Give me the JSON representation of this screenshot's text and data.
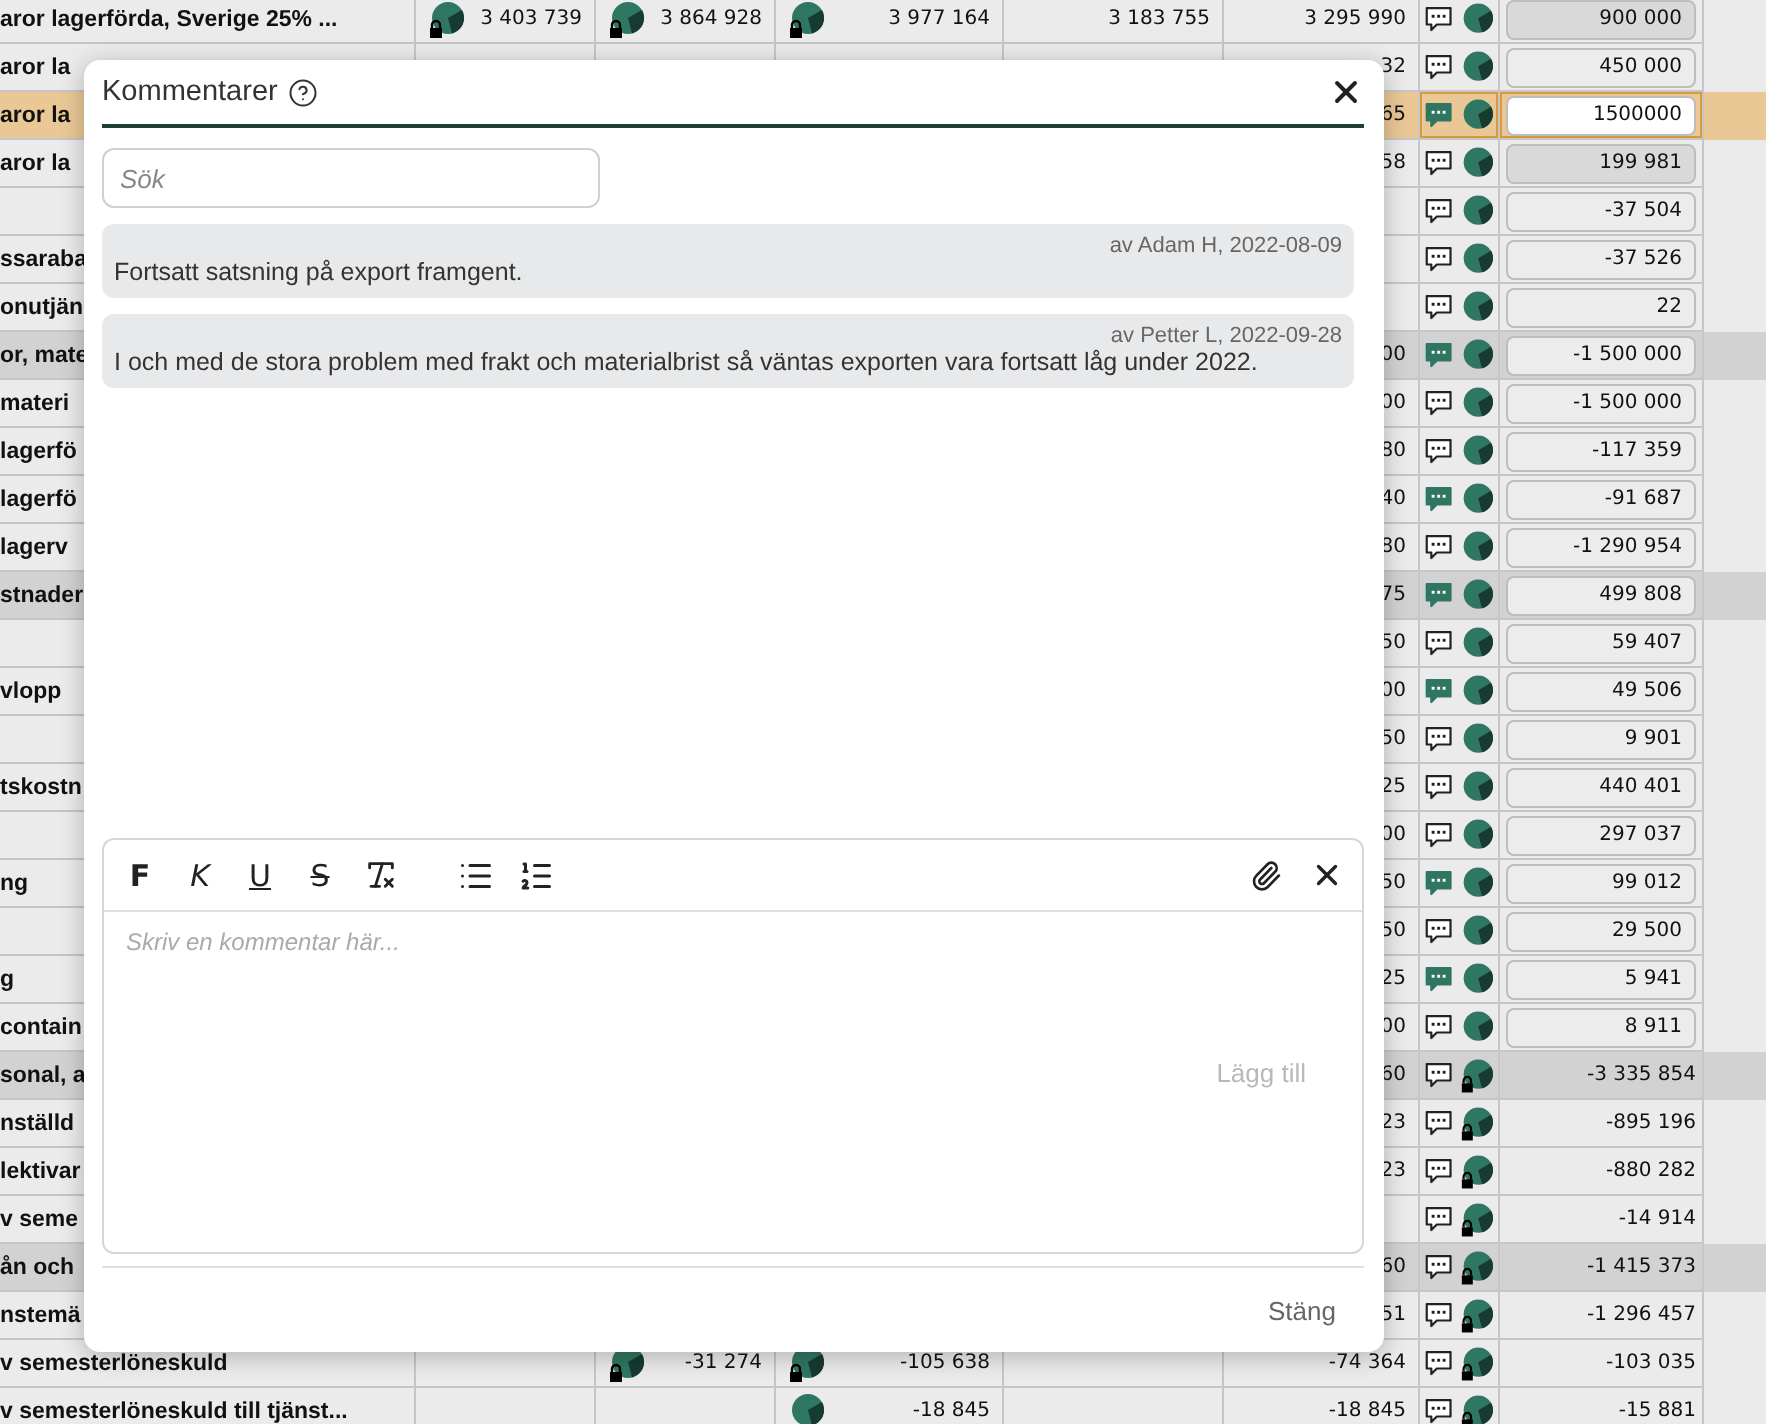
{
  "table": {
    "rows": [
      {
        "name": "aror lagerförda, Sverige 25% ...",
        "group": false,
        "selected": false,
        "column_1": {
          "text": "3 403 739",
          "chart_icon": true,
          "locked": true
        },
        "column_2": {
          "text": "3 864 928",
          "chart_icon": true,
          "locked": true
        },
        "column_3": {
          "text": "3 977 164",
          "chart_icon": true,
          "locked": true
        },
        "column_4": {
          "text": "3 183 755"
        },
        "column_5": {
          "text": "3 295 990"
        },
        "commented": false,
        "value_locked": false,
        "value": "900 000",
        "kind": "field",
        "edited": true
      },
      {
        "name": "aror la",
        "group": false,
        "selected": false,
        "column_5": {
          "text": "32"
        },
        "commented": false,
        "value_locked": false,
        "value": "450 000",
        "kind": "field",
        "edited": false
      },
      {
        "name": "aror la",
        "group": false,
        "selected": true,
        "column_5": {
          "text": "65"
        },
        "commented": true,
        "value_locked": false,
        "value": "1500000",
        "kind": "field",
        "edited": false
      },
      {
        "name": "aror la",
        "group": false,
        "selected": false,
        "column_5": {
          "text": "58"
        },
        "commented": false,
        "value_locked": false,
        "value": "199 981",
        "kind": "field",
        "edited": true
      },
      {
        "group": false,
        "selected": false,
        "commented": false,
        "value_locked": false,
        "value": "-37 504",
        "kind": "field",
        "edited": false
      },
      {
        "name": "ssaraba",
        "group": false,
        "selected": false,
        "commented": false,
        "value_locked": false,
        "value": "-37 526",
        "kind": "field",
        "edited": false
      },
      {
        "name": "onutjän",
        "group": false,
        "selected": false,
        "commented": false,
        "value_locked": false,
        "value": "22",
        "kind": "field",
        "edited": false
      },
      {
        "name": "or, mate",
        "group": true,
        "selected": false,
        "column_5": {
          "text": "00"
        },
        "commented": true,
        "value_locked": false,
        "value": "-1 500 000",
        "kind": "field",
        "edited": false
      },
      {
        "name": "materi",
        "group": false,
        "selected": false,
        "column_5": {
          "text": "00"
        },
        "commented": false,
        "value_locked": false,
        "value": "-1 500 000",
        "kind": "field",
        "edited": false
      },
      {
        "name": "lagerfö",
        "group": false,
        "selected": false,
        "column_5": {
          "text": "80"
        },
        "commented": false,
        "value_locked": false,
        "value": "-117 359",
        "kind": "field",
        "edited": false
      },
      {
        "name": "lagerfö",
        "group": false,
        "selected": false,
        "column_5": {
          "text": "40"
        },
        "commented": true,
        "value_locked": false,
        "value": "-91 687",
        "kind": "field",
        "edited": false
      },
      {
        "name": "lagerv",
        "group": false,
        "selected": false,
        "column_5": {
          "text": "80"
        },
        "commented": false,
        "value_locked": false,
        "value": "-1 290 954",
        "kind": "field",
        "edited": false
      },
      {
        "name": "stnader",
        "group": true,
        "selected": false,
        "column_5": {
          "text": "75"
        },
        "commented": true,
        "value_locked": false,
        "value": "499 808",
        "kind": "field",
        "edited": false
      },
      {
        "group": false,
        "selected": false,
        "column_5": {
          "text": "50"
        },
        "commented": false,
        "value_locked": false,
        "value": "59 407",
        "kind": "field",
        "edited": false
      },
      {
        "name": "vlopp",
        "group": false,
        "selected": false,
        "column_5": {
          "text": "00"
        },
        "commented": true,
        "value_locked": false,
        "value": "49 506",
        "kind": "field",
        "edited": false
      },
      {
        "group": false,
        "selected": false,
        "column_5": {
          "text": "50"
        },
        "commented": false,
        "value_locked": false,
        "value": "9 901",
        "kind": "field",
        "edited": false
      },
      {
        "name": "tskostn",
        "group": false,
        "selected": false,
        "column_5": {
          "text": "25"
        },
        "commented": false,
        "value_locked": false,
        "value": "440 401",
        "kind": "field",
        "edited": false
      },
      {
        "group": false,
        "selected": false,
        "column_5": {
          "text": "00"
        },
        "commented": false,
        "value_locked": false,
        "value": "297 037",
        "kind": "field",
        "edited": false
      },
      {
        "name": "ng",
        "group": false,
        "selected": false,
        "column_5": {
          "text": "50"
        },
        "commented": true,
        "value_locked": false,
        "value": "99 012",
        "kind": "field",
        "edited": false
      },
      {
        "group": false,
        "selected": false,
        "column_5": {
          "text": "50"
        },
        "commented": false,
        "value_locked": false,
        "value": "29 500",
        "kind": "field",
        "edited": false
      },
      {
        "name": "g",
        "group": false,
        "selected": false,
        "column_5": {
          "text": "25"
        },
        "commented": true,
        "value_locked": false,
        "value": "5 941",
        "kind": "field",
        "edited": false
      },
      {
        "name": "contain",
        "group": false,
        "selected": false,
        "column_5": {
          "text": "00"
        },
        "commented": false,
        "value_locked": false,
        "value": "8 911",
        "kind": "field",
        "edited": false
      },
      {
        "name": "sonal, a",
        "group": true,
        "selected": false,
        "column_5": {
          "text": "60"
        },
        "commented": false,
        "value_locked": true,
        "value": "-3 335 854",
        "kind": "plain"
      },
      {
        "name": "nställd",
        "group": false,
        "selected": false,
        "column_5": {
          "text": "23"
        },
        "commented": false,
        "value_locked": true,
        "value": "-895 196",
        "kind": "plain"
      },
      {
        "name": "lektivar",
        "group": false,
        "selected": false,
        "column_5": {
          "text": "23"
        },
        "commented": false,
        "value_locked": true,
        "value": "-880 282",
        "kind": "plain"
      },
      {
        "name": "v seme",
        "group": false,
        "selected": false,
        "commented": false,
        "value_locked": true,
        "value": "-14 914",
        "kind": "plain"
      },
      {
        "name": "ån och",
        "group": true,
        "selected": false,
        "column_5": {
          "text": "60"
        },
        "commented": false,
        "value_locked": true,
        "value": "-1 415 373",
        "kind": "plain"
      },
      {
        "name": "nstemä",
        "group": false,
        "selected": false,
        "column_5": {
          "text": "51"
        },
        "commented": false,
        "value_locked": true,
        "value": "-1 296 457",
        "kind": "plain"
      },
      {
        "name": "v semesterlöneskuld",
        "group": false,
        "selected": false,
        "column_2": {
          "text": "-31 274",
          "chart_icon": true,
          "locked": true
        },
        "column_3": {
          "text": "-105 638",
          "chart_icon": true,
          "locked": true
        },
        "column_5": {
          "text": "-74 364"
        },
        "commented": false,
        "value_locked": true,
        "value": "-103 035",
        "kind": "plain"
      },
      {
        "name": "v semesterlöneskuld till tjänst...",
        "group": false,
        "selected": false,
        "column_3": {
          "text": "-18 845",
          "chart_icon": true,
          "locked": false
        },
        "column_5": {
          "text": "-18 845"
        },
        "commented": false,
        "value_locked": true,
        "value": "-15 881",
        "kind": "plain"
      }
    ]
  },
  "modal": {
    "title": "Kommentarer",
    "search": {
      "placeholder": "Sök"
    },
    "comments": [
      {
        "meta": "av Adam H, 2022-08-09",
        "text": "Fortsatt satsning på export framgent."
      },
      {
        "meta": "av Petter L, 2022-09-28",
        "text": "I och med de stora problem med frakt och materialbrist så väntas exporten vara fortsatt låg under 2022."
      }
    ],
    "editor": {
      "toolbar": [
        {
          "kind": "bold",
          "label": "F"
        },
        {
          "kind": "italic",
          "label": "K"
        },
        {
          "kind": "underline",
          "label": "U"
        },
        {
          "kind": "strike",
          "label": "S"
        },
        {
          "kind": "clear"
        },
        {
          "kind": "bullets"
        },
        {
          "kind": "numbered"
        }
      ],
      "placeholder": "Skriv en kommentar här...",
      "submit": {
        "label": "Lägg till",
        "disabled": true
      }
    },
    "close_label": "Stäng"
  }
}
